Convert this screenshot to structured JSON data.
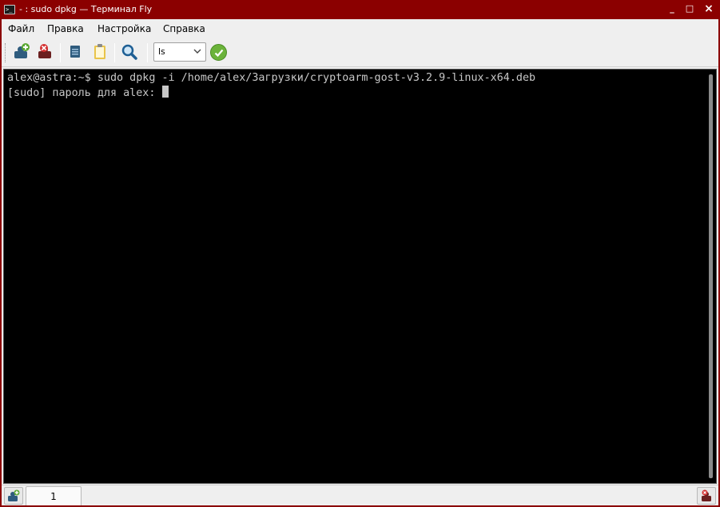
{
  "window": {
    "title": "- : sudo dpkg — Терминал Fly",
    "icon_glyph": ">_",
    "minimize": "_",
    "maximize": "□",
    "close": "×"
  },
  "menu": {
    "items": [
      "Файл",
      "Правка",
      "Настройка",
      "Справка"
    ]
  },
  "toolbar": {
    "buttons": [
      {
        "name": "new-session-icon"
      },
      {
        "name": "close-session-icon"
      },
      {
        "name": "copy-icon"
      },
      {
        "name": "paste-icon"
      },
      {
        "name": "search-icon"
      }
    ],
    "command_combo_value": "ls",
    "run_icon": "checkmark-icon"
  },
  "terminal": {
    "lines": [
      "alex@astra:~$ sudo dpkg -i /home/alex/Загрузки/cryptoarm-gost-v3.2.9-linux-x64.deb",
      "[sudo] пароль для alex: "
    ]
  },
  "tabs": {
    "items": [
      {
        "label": "1"
      }
    ]
  },
  "colors": {
    "titlebar": "#8b0000",
    "terminal_bg": "#000000",
    "terminal_fg": "#c8c8c8",
    "accent_green": "#6bb33a"
  }
}
